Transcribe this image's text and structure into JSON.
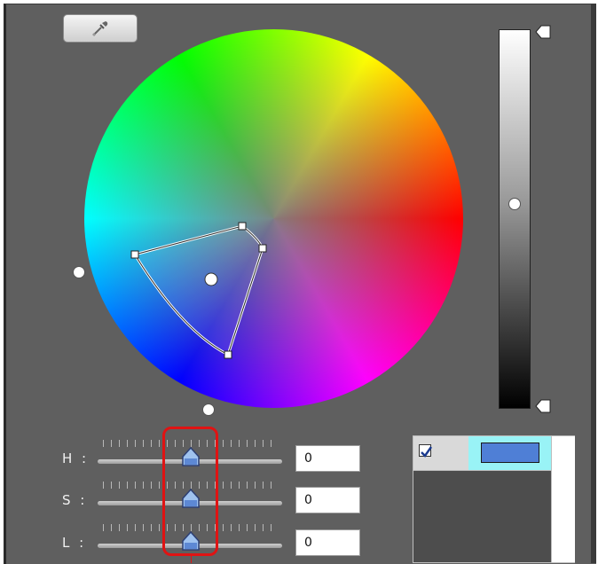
{
  "tools": {
    "eyedropper_icon": "eyedropper-icon"
  },
  "colors": {
    "panel_bg": "#5f5f5f",
    "swatch_fill": "#4f7fd6",
    "swatch_selected_bg": "#99f3f6",
    "highlight": "#e01313"
  },
  "sliders": [
    {
      "label": "H :",
      "value": "0",
      "position": 0.5
    },
    {
      "label": "S :",
      "value": "0",
      "position": 0.5
    },
    {
      "label": "L :",
      "value": "0",
      "position": 0.5
    }
  ],
  "swatches": [
    {
      "checked": true,
      "color": "#4f7fd6"
    }
  ]
}
